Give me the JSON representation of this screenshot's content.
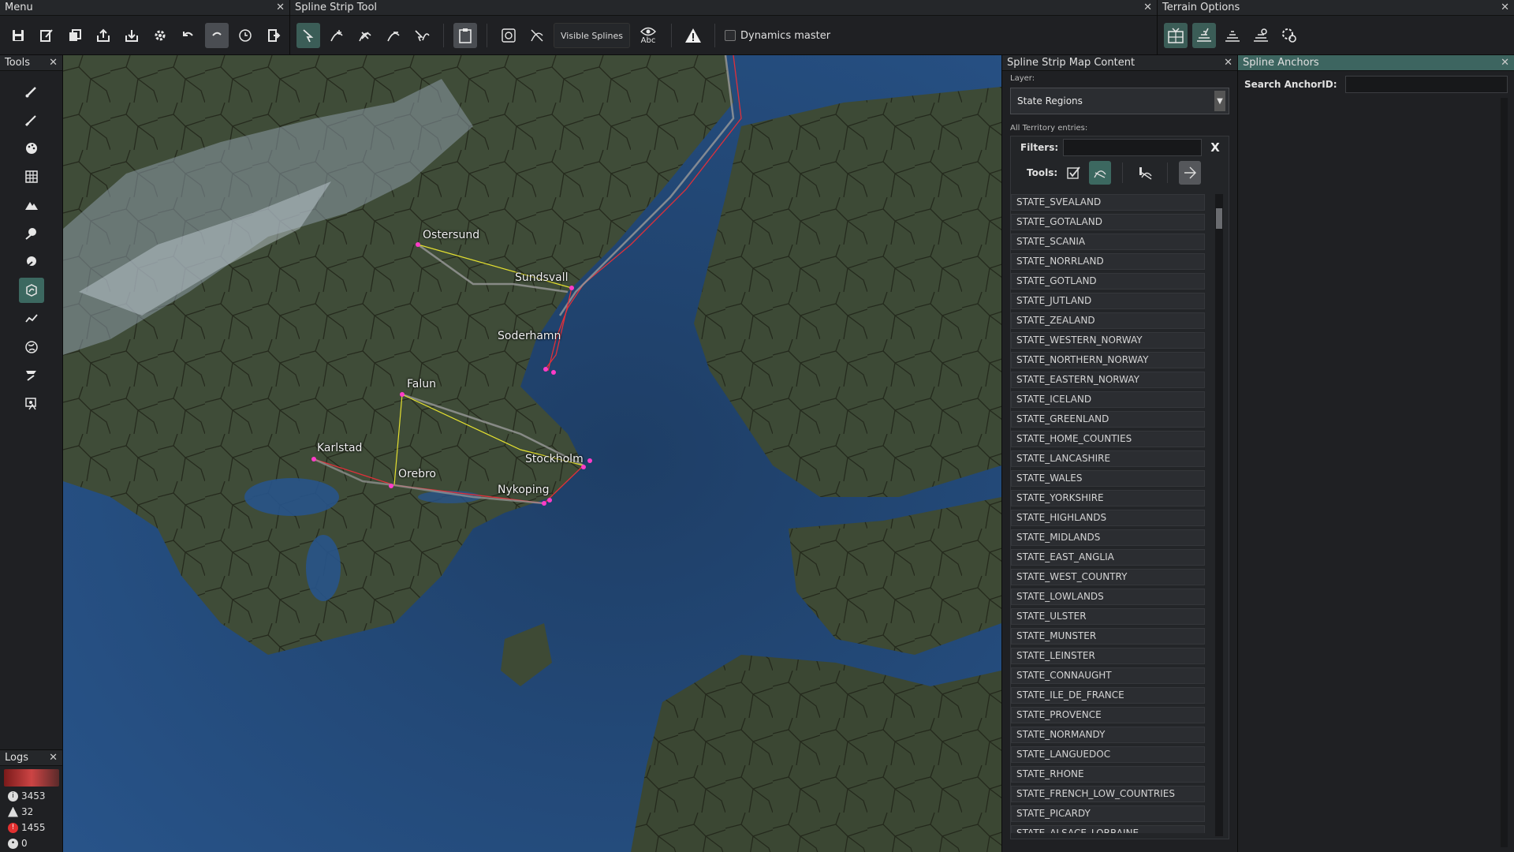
{
  "menu": {
    "title": "Menu"
  },
  "spline_tool": {
    "title": "Spline Strip Tool",
    "visible_splines_label": "Visible Splines",
    "abc_label": "Abc",
    "dynamics_label": "Dynamics master"
  },
  "terrain": {
    "title": "Terrain Options"
  },
  "tools_panel": {
    "title": "Tools"
  },
  "logs": {
    "title": "Logs",
    "info_count": "3453",
    "warning_count": "32",
    "error_count": "1455",
    "other_count": "0"
  },
  "map": {
    "cities": [
      "Ostersund",
      "Sundsvall",
      "Soderhamn",
      "Falun",
      "Karlstad",
      "Orebro",
      "Stockholm",
      "Nykoping"
    ]
  },
  "content_panel": {
    "title": "Spline Strip Map Content",
    "layer_label": "Layer:",
    "layer_value": "State Regions",
    "entries_label": "All Territory entries:",
    "filters_label": "Filters:",
    "filter_clear": "X",
    "tools_label": "Tools:",
    "states": [
      "STATE_SVEALAND",
      "STATE_GOTALAND",
      "STATE_SCANIA",
      "STATE_NORRLAND",
      "STATE_GOTLAND",
      "STATE_JUTLAND",
      "STATE_ZEALAND",
      "STATE_WESTERN_NORWAY",
      "STATE_NORTHERN_NORWAY",
      "STATE_EASTERN_NORWAY",
      "STATE_ICELAND",
      "STATE_GREENLAND",
      "STATE_HOME_COUNTIES",
      "STATE_LANCASHIRE",
      "STATE_WALES",
      "STATE_YORKSHIRE",
      "STATE_HIGHLANDS",
      "STATE_MIDLANDS",
      "STATE_EAST_ANGLIA",
      "STATE_WEST_COUNTRY",
      "STATE_LOWLANDS",
      "STATE_ULSTER",
      "STATE_MUNSTER",
      "STATE_LEINSTER",
      "STATE_CONNAUGHT",
      "STATE_ILE_DE_FRANCE",
      "STATE_PROVENCE",
      "STATE_NORMANDY",
      "STATE_LANGUEDOC",
      "STATE_RHONE",
      "STATE_FRENCH_LOW_COUNTRIES",
      "STATE_PICARDY",
      "STATE_ALSACE_LORRAINE"
    ]
  },
  "anchors_panel": {
    "title": "Spline Anchors",
    "search_label": "Search AnchorID:"
  },
  "colors": {
    "accent": "#3c6860",
    "spline_red": "#e0303a",
    "spline_yellow": "#e4e030",
    "anchor_pink": "#ff3cc8"
  }
}
